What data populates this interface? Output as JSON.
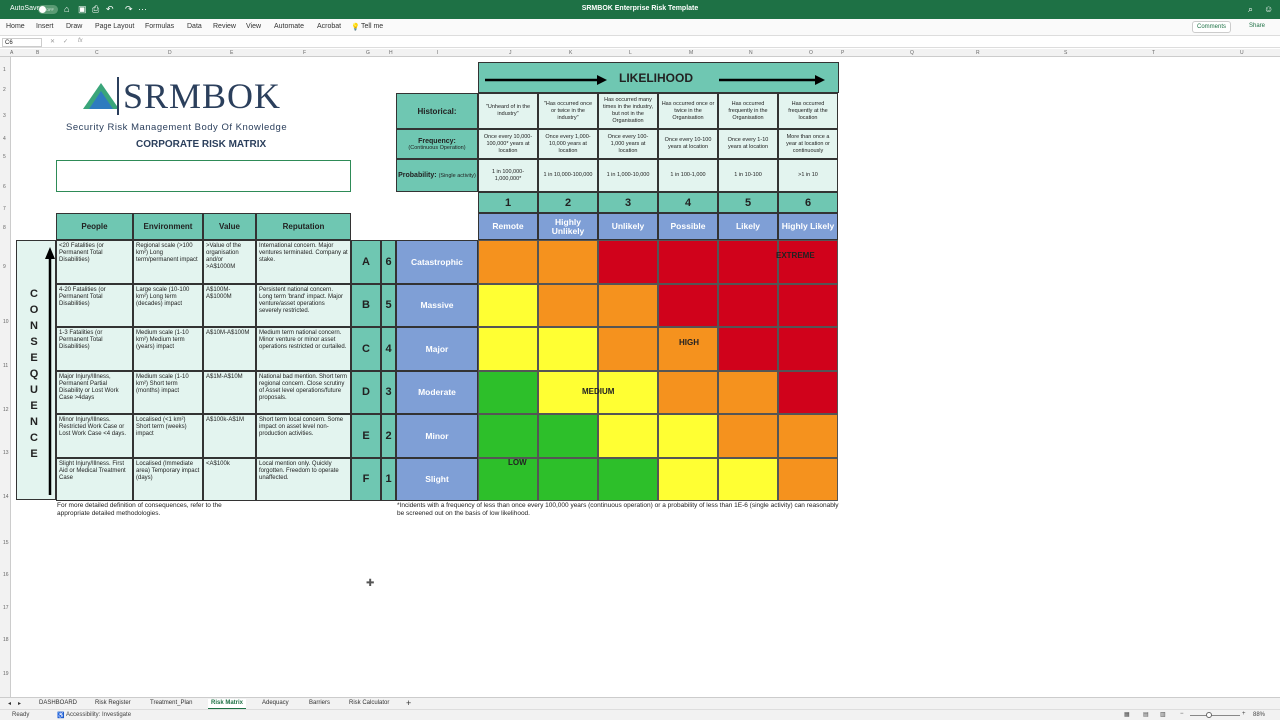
{
  "titlebar": {
    "autosave": "AutoSave",
    "toggle": "OFF",
    "doc_title": "SRMBOK Enterprise Risk Template"
  },
  "ribbon": {
    "tabs": [
      "Home",
      "Insert",
      "Draw",
      "Page Layout",
      "Formulas",
      "Data",
      "Review",
      "View",
      "Automate",
      "Acrobat",
      "Tell me"
    ],
    "comments": "Comments",
    "share": "Share"
  },
  "formula": {
    "cell": "C6",
    "fx": "fx"
  },
  "columns": [
    "A",
    "B",
    "C",
    "D",
    "E",
    "F",
    "G",
    "H",
    "I",
    "J",
    "K",
    "L",
    "M",
    "N",
    "O",
    "P",
    "Q",
    "R",
    "S",
    "T",
    "U"
  ],
  "rows": [
    "1",
    "2",
    "3",
    "4",
    "5",
    "6",
    "7",
    "8",
    "9",
    "10",
    "11",
    "12",
    "13",
    "14",
    "15",
    "16",
    "17",
    "18",
    "19"
  ],
  "brand": {
    "logo": "SRMBOK",
    "tagline": "Security Risk Management Body Of Knowledge",
    "matrix_title": "CORPORATE RISK MATRIX"
  },
  "likelihood": {
    "title": "LIKELIHOOD",
    "historical_label": "Historical:",
    "frequency_label": "Frequency:",
    "frequency_sub": "(Continuous Operation)",
    "probability_label": "Probability:",
    "probability_sub": "(Single activity)",
    "historical": [
      "\"Unheard of in the industry\"",
      "\"Has occurred once or twice in the industry\"",
      "Has occurred many times in the industry, but not in the Organisation",
      "Has occurred once or twice in the Organisation",
      "Has occurred frequently in the Organisation",
      "Has occurred frequently at the location"
    ],
    "frequency": [
      "Once every 10,000-100,000* years at location",
      "Once every 1,000-10,000 years at location",
      "Once every 100-1,000 years at location",
      "Once every 10-100 years at location",
      "Once every 1-10 years at location",
      "More than once a year at location or continuously"
    ],
    "probability": [
      "1 in 100,000-1,000,000*",
      "1 in 10,000-100,000",
      "1 in 1,000-10,000",
      "1 in 100-1,000",
      "1 in 10-100",
      ">1 in 10"
    ],
    "numbers": [
      "1",
      "2",
      "3",
      "4",
      "5",
      "6"
    ],
    "names": [
      "Remote",
      "Highly Unlikely",
      "Unlikely",
      "Possible",
      "Likely",
      "Highly Likely"
    ]
  },
  "consequence": {
    "vertical_label": [
      "C",
      "O",
      "N",
      "S",
      "E",
      "Q",
      "U",
      "E",
      "N",
      "C",
      "E"
    ],
    "headers": [
      "People",
      "Environment",
      "Value",
      "Reputation"
    ],
    "rows": [
      {
        "people": "<20 Fatalities (or Permanent Total Disabilities)",
        "environment": "Regional scale (>100 km²) Long term/permanent impact",
        "value": ">Value of the organisation and/or >A$1000M",
        "reputation": "International concern. Major ventures terminated. Company at stake.",
        "letter": "A",
        "num": "6",
        "name": "Catastrophic"
      },
      {
        "people": "4-20 Fatalities (or Permanent Total Disabilities)",
        "environment": "Large scale (10-100 km²) Long term (decades) impact",
        "value": "A$100M-A$1000M",
        "reputation": "Persistent national concern. Long term 'brand' impact. Major venture/asset operations severely restricted.",
        "letter": "B",
        "num": "5",
        "name": "Massive"
      },
      {
        "people": "1-3 Fatalities (or Permanent Total Disabilities)",
        "environment": "Medium scale (1-10 km²) Medium term (years) impact",
        "value": "A$10M-A$100M",
        "reputation": "Medium term national concern. Minor venture or minor asset operations restricted or curtailed.",
        "letter": "C",
        "num": "4",
        "name": "Major"
      },
      {
        "people": "Major Injury/Illness, Permanent Partial Disability or Lost Work Case >4days",
        "environment": "Medium scale (1-10 km²) Short term (months) impact",
        "value": "A$1M-A$10M",
        "reputation": "National bad mention. Short term regional concern. Close scrutiny of Asset level operations/future proposals.",
        "letter": "D",
        "num": "3",
        "name": "Moderate"
      },
      {
        "people": "Minor Injury/Illness. Restricted Work Case or Lost Work Case <4 days.",
        "environment": "Localised (<1 km²) Short term (weeks) impact",
        "value": "A$100k-A$1M",
        "reputation": "Short term local concern. Some impact on asset level non-production activities.",
        "letter": "E",
        "num": "2",
        "name": "Minor"
      },
      {
        "people": "Slight Injury/Illness. First Aid or Medical Treatment Case",
        "environment": "Localised (Immediate area) Temporary impact (days)",
        "value": "<A$100k",
        "reputation": "Local mention only. Quickly forgotten. Freedom to operate unaffected.",
        "letter": "F",
        "num": "1",
        "name": "Slight"
      }
    ],
    "footnote": "For more detailed definition of consequences, refer to the appropriate detailed methodologies."
  },
  "matrix": {
    "colors": {
      "R": "#d0021b",
      "O": "#f5921e",
      "Y": "#ffff33",
      "G": "#2dbf2a"
    },
    "grid": [
      [
        "O",
        "O",
        "R",
        "R",
        "R",
        "R"
      ],
      [
        "Y",
        "O",
        "O",
        "R",
        "R",
        "R"
      ],
      [
        "Y",
        "Y",
        "O",
        "O",
        "R",
        "R"
      ],
      [
        "G",
        "Y",
        "Y",
        "O",
        "O",
        "R"
      ],
      [
        "G",
        "G",
        "Y",
        "Y",
        "O",
        "O"
      ],
      [
        "G",
        "G",
        "G",
        "Y",
        "Y",
        "O"
      ]
    ],
    "labels": {
      "extreme": "EXTREME",
      "high": "HIGH",
      "medium": "MEDIUM",
      "low": "LOW"
    },
    "footnote": "*Incidents with a frequency of less than once every 100,000 years (continuous operation) or a probability of less than 1E-6 (single activity) can reasonably be screened out on the basis of low likelihood."
  },
  "sheet_tabs": [
    "DASHBOARD",
    "Risk Register",
    "Treatment_Plan",
    "Risk Matrix",
    "Adequacy",
    "Barriers",
    "Risk Calculator"
  ],
  "active_tab": "Risk Matrix",
  "status": {
    "ready": "Ready",
    "accessibility": "Accessibility: Investigate",
    "zoom": "88%"
  }
}
